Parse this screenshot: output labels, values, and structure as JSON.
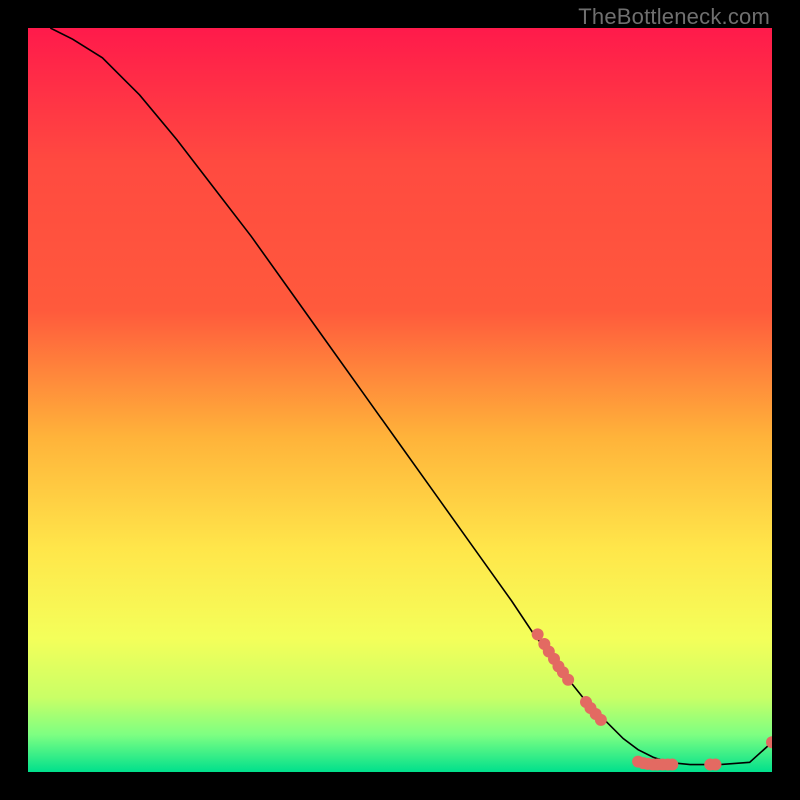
{
  "watermark": "TheBottleneck.com",
  "colors": {
    "grad_top": "#ff1a4b",
    "grad_mid1": "#ff5a3c",
    "grad_mid2": "#ffb33a",
    "grad_mid3": "#ffe64a",
    "grad_low1": "#f4ff5a",
    "grad_low2": "#c9ff66",
    "grad_low3": "#7dff82",
    "grad_bottom": "#00e08c",
    "line": "#000000",
    "marker": "#e36a62"
  },
  "chart_data": {
    "type": "line",
    "title": "",
    "xlabel": "",
    "ylabel": "",
    "xlim": [
      0,
      100
    ],
    "ylim": [
      0,
      100
    ],
    "legend": false,
    "grid": false,
    "series": [
      {
        "name": "curve",
        "x": [
          3,
          6,
          10,
          15,
          20,
          25,
          30,
          35,
          40,
          45,
          50,
          55,
          60,
          65,
          68,
          70,
          73,
          75,
          78,
          80,
          82,
          84,
          86,
          89,
          93,
          97,
          100
        ],
        "y": [
          100,
          98.5,
          96,
          91,
          85,
          78.5,
          72,
          65,
          58,
          51,
          44,
          37,
          30,
          23,
          18.5,
          16,
          12,
          9.5,
          6.5,
          4.5,
          3,
          2,
          1.3,
          1,
          1,
          1.3,
          4
        ]
      }
    ],
    "markers": [
      {
        "x": 68.5,
        "y": 18.5
      },
      {
        "x": 69.4,
        "y": 17.2
      },
      {
        "x": 70.0,
        "y": 16.2
      },
      {
        "x": 70.7,
        "y": 15.2
      },
      {
        "x": 71.3,
        "y": 14.2
      },
      {
        "x": 71.9,
        "y": 13.4
      },
      {
        "x": 72.6,
        "y": 12.4
      },
      {
        "x": 75.0,
        "y": 9.4
      },
      {
        "x": 75.6,
        "y": 8.6
      },
      {
        "x": 76.3,
        "y": 7.8
      },
      {
        "x": 77.0,
        "y": 7.0
      },
      {
        "x": 82.0,
        "y": 1.4
      },
      {
        "x": 82.7,
        "y": 1.2
      },
      {
        "x": 83.3,
        "y": 1.1
      },
      {
        "x": 84.0,
        "y": 1.0
      },
      {
        "x": 84.6,
        "y": 1.0
      },
      {
        "x": 85.3,
        "y": 1.0
      },
      {
        "x": 86.0,
        "y": 1.0
      },
      {
        "x": 86.6,
        "y": 1.0
      },
      {
        "x": 91.7,
        "y": 1.0
      },
      {
        "x": 92.4,
        "y": 1.0
      },
      {
        "x": 100.0,
        "y": 4.0
      }
    ]
  }
}
